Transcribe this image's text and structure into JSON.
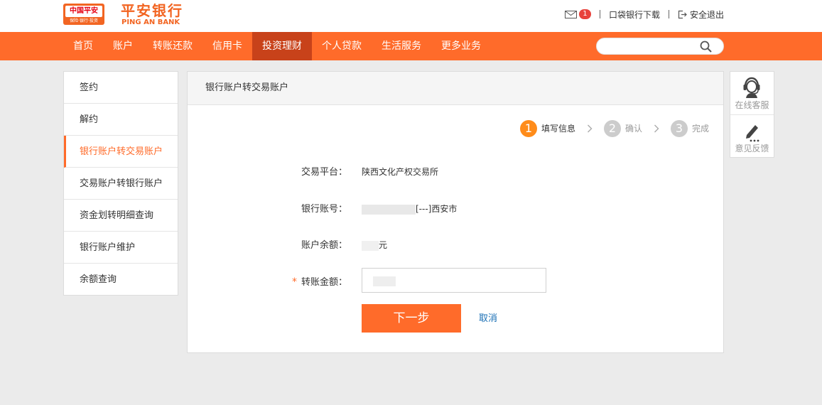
{
  "header": {
    "logo_badge_text": "中国平安",
    "logo_badge_sub": "保险·银行·投资",
    "bank_name_cn": "平安银行",
    "bank_name_en": "PING AN BANK",
    "message_count": "1",
    "download_link": "口袋银行下载",
    "logout_link": "安全退出"
  },
  "nav": {
    "items": [
      {
        "label": "首页"
      },
      {
        "label": "账户"
      },
      {
        "label": "转账还款"
      },
      {
        "label": "信用卡"
      },
      {
        "label": "投资理财"
      },
      {
        "label": "个人贷款"
      },
      {
        "label": "生活服务"
      },
      {
        "label": "更多业务"
      }
    ],
    "active_index": 4,
    "search_placeholder": ""
  },
  "sidebar": {
    "items": [
      {
        "label": "签约"
      },
      {
        "label": "解约"
      },
      {
        "label": "银行账户转交易账户"
      },
      {
        "label": "交易账户转银行账户"
      },
      {
        "label": "资金划转明细查询"
      },
      {
        "label": "银行账户维护"
      },
      {
        "label": "余额查询"
      }
    ],
    "active_index": 2
  },
  "main": {
    "title": "银行账户转交易账户",
    "steps": [
      {
        "num": "1",
        "label": "填写信息"
      },
      {
        "num": "2",
        "label": "确认"
      },
      {
        "num": "3",
        "label": "完成"
      }
    ],
    "current_step": 1,
    "form": {
      "platform_label": "交易平台：",
      "platform_value": "陕西文化产权交易所",
      "account_label": "银行账号：",
      "account_suffix": "[---]西安市",
      "balance_label": "账户余额：",
      "balance_unit": "元",
      "amount_required_mark": "*",
      "amount_label": "转账金额：",
      "next_button": "下一步",
      "cancel_link": "取消"
    }
  },
  "float_panel": {
    "service_label": "在线客服",
    "feedback_label": "意见反馈"
  },
  "colors": {
    "brand_orange": "#ff6b2a",
    "nav_active": "#c8421a",
    "step_active": "#ff8c1a",
    "step_inactive": "#cccccc",
    "link_blue": "#1a6fb5"
  }
}
